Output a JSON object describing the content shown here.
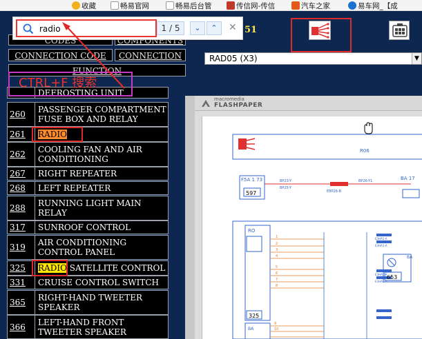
{
  "bookmarks": [
    {
      "label": "收藏",
      "icon": "star-icon",
      "color": "#f2b01e"
    },
    {
      "label": "畅易官网",
      "icon": "doc-icon",
      "color": "#777777"
    },
    {
      "label": "畅易后台管",
      "icon": "doc-icon",
      "color": "#777777"
    },
    {
      "label": "传信网-传信",
      "icon": "chuan-logo-icon",
      "color": "#c0392b"
    },
    {
      "label": "汽车之家",
      "icon": "car-home-icon",
      "color": "#e35b1b"
    },
    {
      "label": "易车网_【成",
      "icon": "yiche-icon",
      "color": "#1f6fd0"
    }
  ],
  "find": {
    "query": "radio",
    "count": "1 / 5",
    "placeholder": ""
  },
  "header": {
    "partial_char": "51"
  },
  "nav": {
    "codes": "CODES",
    "components": "COMPONENTS",
    "connection_code": "CONNECTION CODE",
    "connection": "CONNECTION",
    "function": "FUNCTION"
  },
  "list_partial": "DEFROSTING UNIT",
  "rows": [
    {
      "num": "260",
      "title": "PASSENGER COMPARTMENT FUSE BOX AND RELAY"
    },
    {
      "num": "261",
      "title": "RADIO"
    },
    {
      "num": "262",
      "title": "COOLING FAN AND AIR CONDITIONING"
    },
    {
      "num": "267",
      "title": "RIGHT REPEATER"
    },
    {
      "num": "268",
      "title": "LEFT REPEATER"
    },
    {
      "num": "288",
      "title": "RUNNING LIGHT MAIN RELAY"
    },
    {
      "num": "317",
      "title": "SUNROOF CONTROL"
    },
    {
      "num": "319",
      "title": "AIR CONDITIONING CONTROL PANEL"
    },
    {
      "num": "325",
      "title_hl": "RADIO",
      "title_rest": " SATELLITE CONTROL"
    },
    {
      "num": "331",
      "title": "CRUISE CONTROL SWITCH"
    },
    {
      "num": "365",
      "title": "RIGHT-HAND TWEETER SPEAKER"
    },
    {
      "num": "366",
      "title": "LEFT-HAND FRONT TWEETER SPEAKER"
    }
  ],
  "dropdown": {
    "selected": "RAD05 (X3)"
  },
  "viewer": {
    "brand_top": "macromedia",
    "brand_bottom": "FLASHPAPER",
    "cursor_icon": "hand-cursor-icon"
  },
  "diagram": {
    "top_label": "R06",
    "box_a_label": "F5A  1  73",
    "box_a_code": "597",
    "box_b_code": "653",
    "box_c_code": "325",
    "box_right_label": "BA  17",
    "mid_label": "EBP26-B",
    "wire_labels": [
      "BP23-Y",
      "BP25-Y",
      "BP26-Y1",
      "BP25-Y"
    ],
    "side_labels": [
      "RO",
      "BA",
      "BA"
    ],
    "left_numbers": [
      "1",
      "2",
      "3",
      "4",
      "5",
      "6",
      "7",
      "8",
      "9",
      "10"
    ],
    "right_tags": [
      "E3HA1-A",
      "E3HA1-A",
      "E3HA1-A",
      "E3HA1-A",
      "E3HA1-A",
      "E3HA1-A"
    ]
  },
  "annotation": {
    "text": "CTRL+F 搜索"
  },
  "colors": {
    "app_bg": "#0e2750",
    "highlight": "#ffe600",
    "current_highlight": "#ff8c2a",
    "annotation_red": "#e02a2a",
    "annotation_magenta": "#c739c7"
  }
}
